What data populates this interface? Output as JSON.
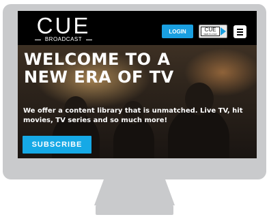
{
  "brand": {
    "logo_text": "CUE",
    "logo_subtitle": "BROADCAST"
  },
  "header": {
    "login_label": "LOGIN",
    "player_badge": {
      "logo_text": "CUE",
      "subtitle": "WEB PLAYER"
    },
    "menu_icon": "hamburger-menu-icon"
  },
  "hero": {
    "title_line1": "WELCOME TO A",
    "title_line2": "NEW ERA OF TV",
    "text_line1": "We offer a content library that is unmatched. Live TV, hit",
    "text_line2": "movies, TV series and so much more!",
    "cta_label": "SUBSCRIBE"
  },
  "colors": {
    "accent": "#16a9e6",
    "header_bg": "#000000",
    "monitor": "#c9cacc"
  }
}
